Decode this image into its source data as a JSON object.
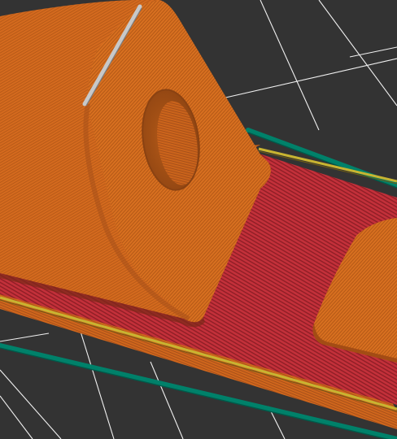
{
  "viewport": {
    "kind": "3d-gcode-preview",
    "colors": {
      "background": "#333333",
      "grid": "#f0f0f0",
      "perimeter": "#d46a1e",
      "perimeter_dark": "#a8501a",
      "solid_infill": "#c3303a",
      "skirt": "#00816a",
      "brim_line": "#c8b431",
      "top_highlight": "#c8c8c8"
    },
    "icons": [
      "model-part-icon",
      "hole-icon"
    ]
  }
}
